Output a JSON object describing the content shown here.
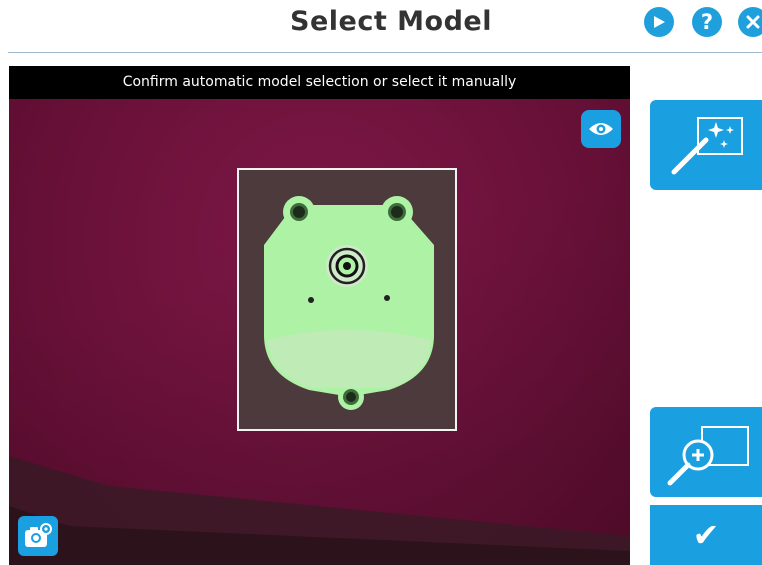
{
  "header": {
    "title": "Select Model",
    "buttons": [
      {
        "name": "play-icon",
        "color": "#1fa0dc"
      },
      {
        "name": "help-icon",
        "glyph": "?",
        "color": "#1fa0dc"
      },
      {
        "name": "close-icon",
        "color": "#1fa0dc"
      }
    ]
  },
  "viewport": {
    "banner": "Confirm automatic model selection or select it manually",
    "background_color": "#6a1139",
    "overlays": {
      "eye_icon": "eye-icon",
      "camera_icon": "camera-settings-icon"
    }
  },
  "side_panel": {
    "auto_select_icon": "magic-wand-icon",
    "manual_select_icon": "zoom-select-icon",
    "confirm_glyph": "✔"
  },
  "colors": {
    "accent": "#1a9fe0",
    "model_highlight": "#aef2a6"
  }
}
